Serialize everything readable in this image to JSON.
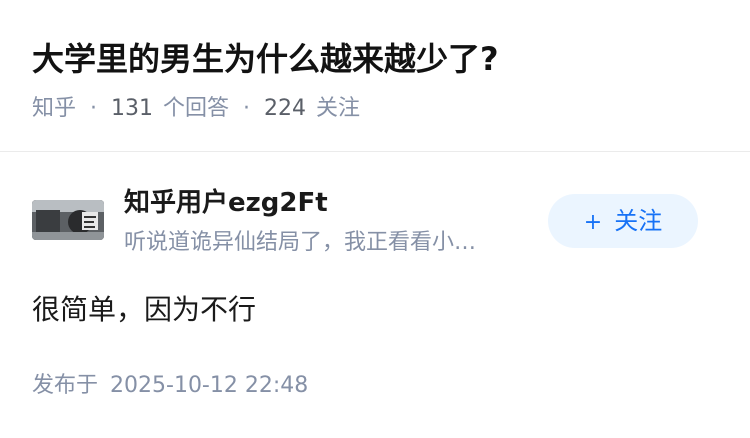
{
  "question": {
    "title": "大学里的男生为什么越来越少了?",
    "source": "知乎",
    "answer_count": "131",
    "answer_label": "个回答",
    "follower_count": "224",
    "follower_label": "关注",
    "separator": "·"
  },
  "answer": {
    "author": {
      "name": "知乎用户ezg2Ft",
      "bio": "听说道诡异仙结局了，我正看看小…",
      "avatar_icon": "user-avatar-image"
    },
    "follow_button": {
      "icon": "+",
      "label": "关注"
    },
    "content": "很简单，因为不行",
    "published_label": "发布于",
    "published_time": "2025-10-12 22:48"
  },
  "colors": {
    "title": "#121212",
    "meta": "#8590a6",
    "follow_bg": "#ebf5ff",
    "follow_text": "#1772f6",
    "divider": "#ebebeb"
  }
}
